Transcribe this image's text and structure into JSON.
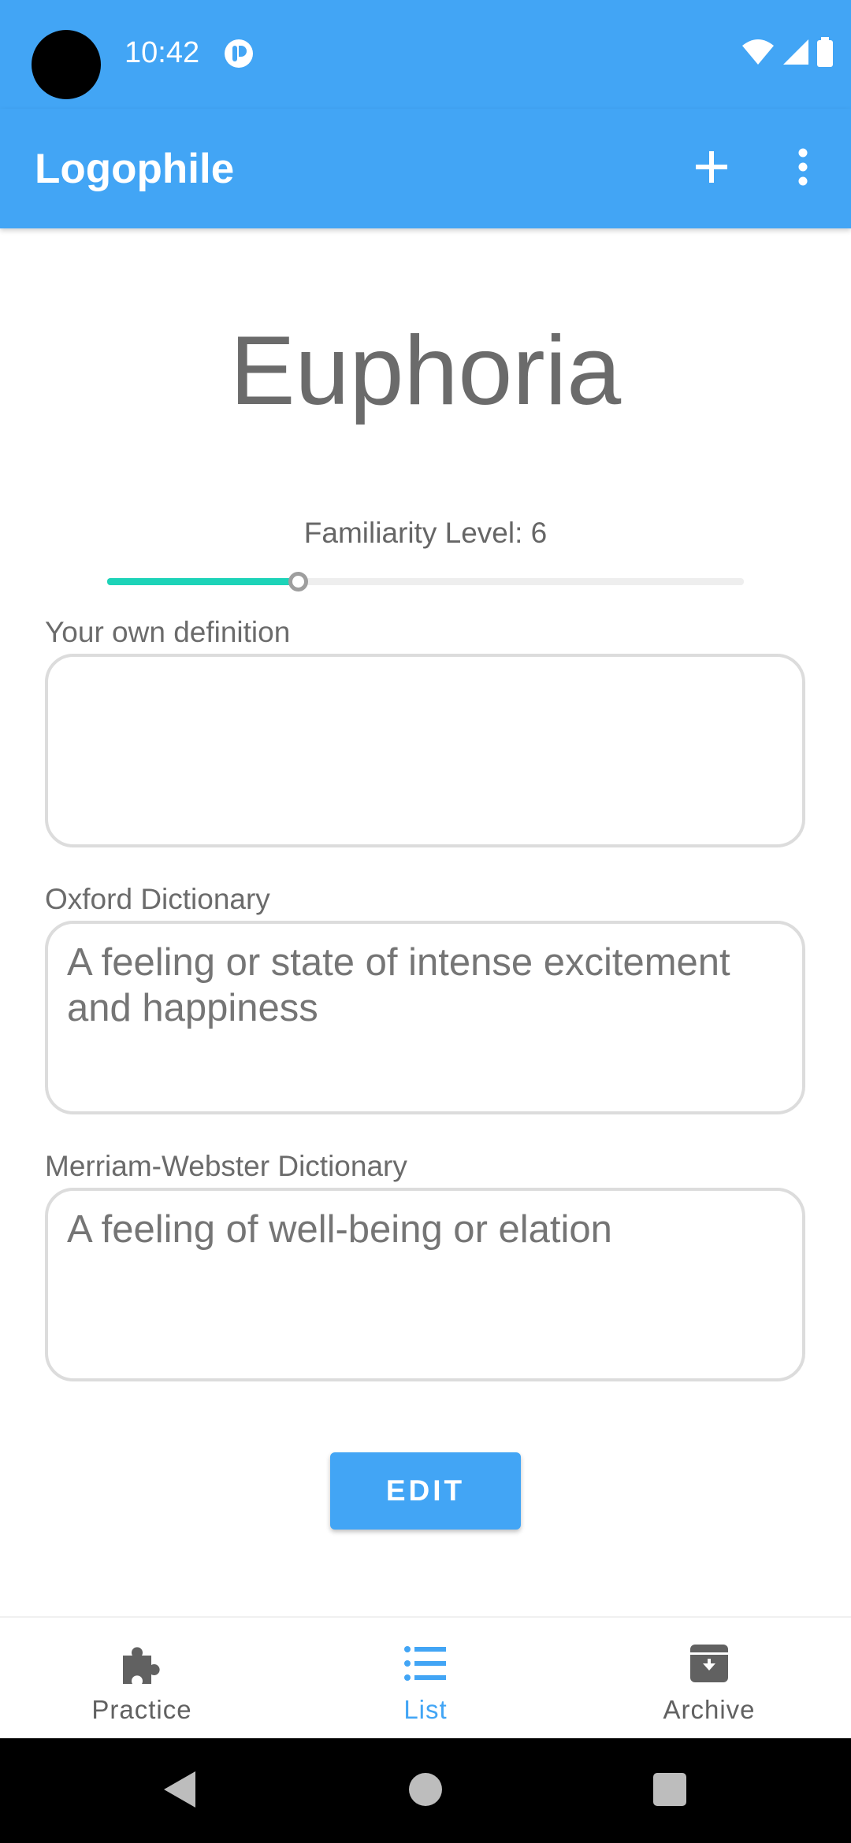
{
  "status_bar": {
    "time": "10:42",
    "notification_icon": "notification-app-icon",
    "wifi_icon": "wifi-icon",
    "signal_icon": "cell-signal-icon",
    "battery_icon": "battery-icon"
  },
  "app_bar": {
    "title": "Logophile",
    "add_icon": "plus-icon",
    "menu_icon": "more-vertical-icon"
  },
  "word": {
    "title": "Euphoria",
    "familiarity_label": "Familiarity Level: 6",
    "familiarity_value": 0.3
  },
  "fields": {
    "own_definition": {
      "label": "Your own definition",
      "value": ""
    },
    "oxford": {
      "label": "Oxford Dictionary",
      "value": "A feeling or state of intense excitement and happiness"
    },
    "merriam_webster": {
      "label": "Merriam-Webster Dictionary",
      "value": "A feeling of well-being or elation"
    }
  },
  "actions": {
    "edit_label": "EDIT"
  },
  "bottom_nav": {
    "items": [
      {
        "label": "Practice",
        "icon": "puzzle-icon",
        "active": false
      },
      {
        "label": "List",
        "icon": "list-icon",
        "active": true
      },
      {
        "label": "Archive",
        "icon": "archive-icon",
        "active": false
      }
    ]
  },
  "colors": {
    "primary": "#42A5F5",
    "accent": "#1DD3B8",
    "nav_inactive": "#616161",
    "nav_active": "#42A5F5"
  }
}
